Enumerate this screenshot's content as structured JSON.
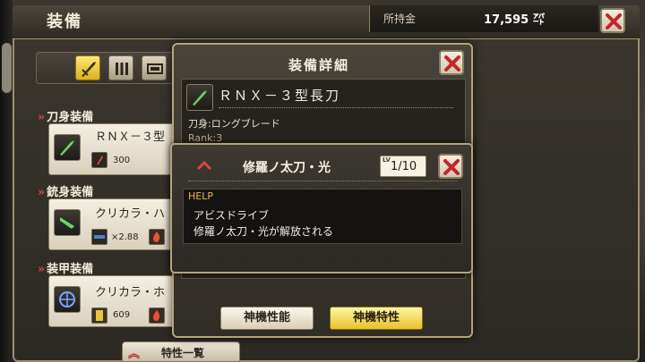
{
  "header": {
    "title": "装備",
    "money_label": "所持金",
    "money_value": "17,595 ㌀"
  },
  "category_tabs": [
    {
      "icon": "blade-icon",
      "active": true
    },
    {
      "icon": "gun-ammo-icon",
      "active": false
    },
    {
      "icon": "armor-icon",
      "active": false
    }
  ],
  "slots": [
    {
      "header": "刀身装備",
      "name": "ＲＮＸ－３型",
      "icon": "blade-icon",
      "stat_icon": "blade-stat-icon",
      "stat": "300"
    },
    {
      "header": "銃身装備",
      "name": "クリカラ・ハ",
      "icon": "gun-icon",
      "stat_icon": "ammo-icon",
      "stat": "×2.88",
      "element_icon": "fire-icon"
    },
    {
      "header": "装甲装備",
      "name": "クリカラ・ホ",
      "icon": "shield-icon",
      "stat_icon": "armor-stat-icon",
      "stat": "609",
      "element_icon": "fire-icon"
    }
  ],
  "bottom_tab": {
    "label": "特性一覧"
  },
  "detail": {
    "title": "装備詳細",
    "item_name": "ＲＮＸ－３型長刀",
    "item_type": "刀身:ロングブレード",
    "item_rank": "Rank:3",
    "buttons": {
      "performance": "神機性能",
      "traits": "神機特性"
    }
  },
  "skill": {
    "name": "修羅ノ太刀・光",
    "level_prefix": "LV",
    "level": "1/10",
    "help_label": "HELP",
    "help_lines": [
      "アビスドライブ",
      "修羅ノ太刀・光が解放される"
    ]
  },
  "colors": {
    "accent_gold": "#e6c22c",
    "accent_red": "#c42b2b",
    "frame_gold": "#b6a37a"
  }
}
